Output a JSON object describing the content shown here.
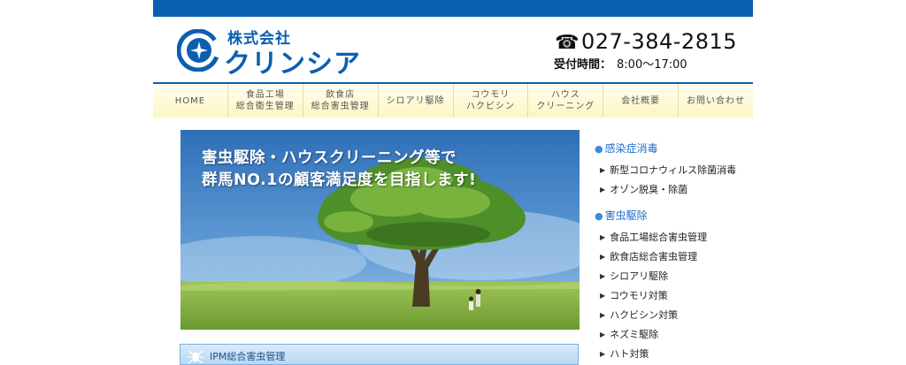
{
  "header": {
    "company_prefix": "株式会社",
    "company_name": "クリンシア",
    "phone_icon": "☎",
    "phone": "027-384-2815",
    "hours_label": "受付時間：",
    "hours_value": "8:00〜17:00"
  },
  "nav": {
    "items": [
      {
        "label": "HOME"
      },
      {
        "label": "食品工場\n総合衛生管理"
      },
      {
        "label": "飲食店\n総合害虫管理"
      },
      {
        "label": "シロアリ駆除"
      },
      {
        "label": "コウモリ\nハクビシン"
      },
      {
        "label": "ハウス\nクリーニング"
      },
      {
        "label": "会社概要"
      },
      {
        "label": "お問い合わせ"
      }
    ]
  },
  "hero": {
    "caption": "害虫駆除・ハウスクリーニング等で\n群馬NO.1の顧客満足度を目指します!"
  },
  "ipm": {
    "label": "IPM総合害虫管理"
  },
  "sidebar": {
    "cat1": {
      "label": "感染症消毒",
      "items": [
        "新型コロナウィルス除菌消毒",
        "オゾン脱臭・除菌"
      ]
    },
    "cat2": {
      "label": "害虫駆除",
      "items": [
        "食品工場総合害虫管理",
        "飲食店総合害虫管理",
        "シロアリ駆除",
        "コウモリ対策",
        "ハクビシン対策",
        "ネズミ駆除",
        "ハト対策"
      ]
    }
  },
  "colors": {
    "brand_blue": "#0b5fb0",
    "nav_bg": "#fdf5c2",
    "link_blue": "#1f6fc8"
  }
}
